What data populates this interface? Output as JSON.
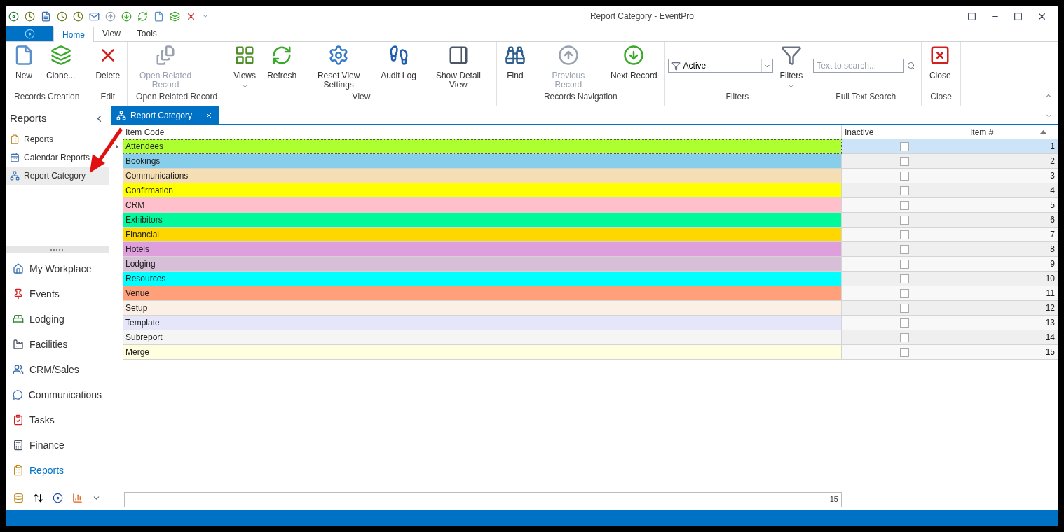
{
  "window": {
    "title": "Report Category - EventPro"
  },
  "ribbon_tabs": [
    {
      "label": "Home",
      "selected": true
    },
    {
      "label": "View",
      "selected": false
    },
    {
      "label": "Tools",
      "selected": false
    }
  ],
  "ribbon_groups": [
    {
      "label": "Records Creation",
      "items": [
        {
          "kind": "button",
          "label": "New",
          "disabled": false,
          "dropdown": false
        },
        {
          "kind": "button",
          "label": "Clone...",
          "disabled": false,
          "dropdown": false
        }
      ]
    },
    {
      "label": "Edit",
      "items": [
        {
          "kind": "button",
          "label": "Delete",
          "disabled": false,
          "dropdown": false
        }
      ]
    },
    {
      "label": "Open Related Record",
      "items": [
        {
          "kind": "button",
          "label": "Open Related Record",
          "disabled": true,
          "dropdown": false
        }
      ]
    },
    {
      "label": "View",
      "items": [
        {
          "kind": "button",
          "label": "Views",
          "disabled": false,
          "dropdown": true
        },
        {
          "kind": "button",
          "label": "Refresh",
          "disabled": false,
          "dropdown": false
        },
        {
          "kind": "button",
          "label": "Reset View Settings",
          "disabled": false,
          "dropdown": false
        },
        {
          "kind": "button",
          "label": "Audit Log",
          "disabled": false,
          "dropdown": false
        },
        {
          "kind": "button",
          "label": "Show Detail View",
          "disabled": false,
          "dropdown": false
        }
      ]
    },
    {
      "label": "Records Navigation",
      "items": [
        {
          "kind": "button",
          "label": "Find",
          "disabled": false,
          "dropdown": false
        },
        {
          "kind": "button",
          "label": "Previous Record",
          "disabled": true,
          "dropdown": false
        },
        {
          "kind": "button",
          "label": "Next Record",
          "disabled": false,
          "dropdown": false
        }
      ]
    },
    {
      "label": "Filters",
      "items": [
        {
          "kind": "combo",
          "value": "Active"
        },
        {
          "kind": "button",
          "label": "Filters",
          "disabled": false,
          "dropdown": true
        }
      ]
    },
    {
      "label": "Full Text Search",
      "items": [
        {
          "kind": "search",
          "placeholder": "Text to search..."
        }
      ]
    },
    {
      "label": "Close",
      "items": [
        {
          "kind": "button",
          "label": "Close",
          "disabled": false,
          "dropdown": false
        }
      ]
    }
  ],
  "sidebar": {
    "title": "Reports",
    "items": [
      {
        "label": "Reports",
        "selected": false
      },
      {
        "label": "Calendar Reports",
        "selected": false
      },
      {
        "label": "Report Category",
        "selected": true
      }
    ]
  },
  "navigation": [
    {
      "label": "My Workplace",
      "selected": false
    },
    {
      "label": "Events",
      "selected": false
    },
    {
      "label": "Lodging",
      "selected": false
    },
    {
      "label": "Facilities",
      "selected": false
    },
    {
      "label": "CRM/Sales",
      "selected": false
    },
    {
      "label": "Communications",
      "selected": false
    },
    {
      "label": "Tasks",
      "selected": false
    },
    {
      "label": "Finance",
      "selected": false
    },
    {
      "label": "Reports",
      "selected": true
    }
  ],
  "document_tabs": [
    {
      "label": "Report Category",
      "selected": true
    }
  ],
  "table": {
    "columns": [
      "Item Code",
      "Inactive",
      "Item #"
    ],
    "sort_ascending": true,
    "rows": [
      {
        "code": "Attendees",
        "color": "#adff2f",
        "inactive": false,
        "number": "1",
        "selected": true
      },
      {
        "code": "Bookings",
        "color": "#87ceeb",
        "inactive": false,
        "number": "2",
        "selected": false
      },
      {
        "code": "Communications",
        "color": "#f5deb3",
        "inactive": false,
        "number": "3",
        "selected": false
      },
      {
        "code": "Confirmation",
        "color": "#ffff00",
        "inactive": false,
        "number": "4",
        "selected": false
      },
      {
        "code": "CRM",
        "color": "#ffc0cb",
        "inactive": false,
        "number": "5",
        "selected": false
      },
      {
        "code": "Exhibitors",
        "color": "#00fa9a",
        "inactive": false,
        "number": "6",
        "selected": false
      },
      {
        "code": "Financial",
        "color": "#ffd700",
        "inactive": false,
        "number": "7",
        "selected": false
      },
      {
        "code": "Hotels",
        "color": "#dda0dd",
        "inactive": false,
        "number": "8",
        "selected": false
      },
      {
        "code": "Lodging",
        "color": "#d8bfd8",
        "inactive": false,
        "number": "9",
        "selected": false
      },
      {
        "code": "Resources",
        "color": "#00ffff",
        "inactive": false,
        "number": "10",
        "selected": false
      },
      {
        "code": "Venue",
        "color": "#ffa07a",
        "inactive": false,
        "number": "11",
        "selected": false
      },
      {
        "code": "Setup",
        "color": "#faf0e6",
        "inactive": false,
        "number": "12",
        "selected": false
      },
      {
        "code": "Template",
        "color": "#e6e6fa",
        "inactive": false,
        "number": "13",
        "selected": false
      },
      {
        "code": "Subreport",
        "color": "#f5f5f5",
        "inactive": false,
        "number": "14",
        "selected": false
      },
      {
        "code": "Merge",
        "color": "#ffffe0",
        "inactive": false,
        "number": "15",
        "selected": false
      }
    ],
    "summary": "15"
  }
}
